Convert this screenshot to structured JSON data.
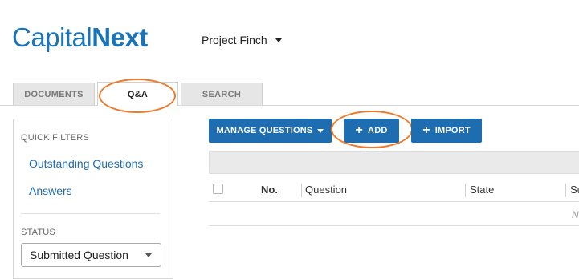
{
  "logo": {
    "part1": "Capital",
    "part2": "Next"
  },
  "project": {
    "name": "Project Finch"
  },
  "tabs": [
    {
      "label": "DOCUMENTS"
    },
    {
      "label": "Q&A"
    },
    {
      "label": "SEARCH"
    }
  ],
  "sidebar": {
    "quick_filters_heading": "QUICK FILTERS",
    "links": [
      {
        "label": "Outstanding Questions"
      },
      {
        "label": "Answers"
      }
    ],
    "status_heading": "STATUS",
    "status_value": "Submitted Question"
  },
  "toolbar": {
    "manage_label": "MANAGE QUESTIONS",
    "add_label": "ADD",
    "import_label": "IMPORT"
  },
  "table": {
    "columns": [
      "No.",
      "Question",
      "State",
      "Su"
    ],
    "empty_text": "N"
  },
  "colors": {
    "brand": "#1a74b8",
    "button": "#1f6db1",
    "highlight": "#ec7a2a"
  }
}
